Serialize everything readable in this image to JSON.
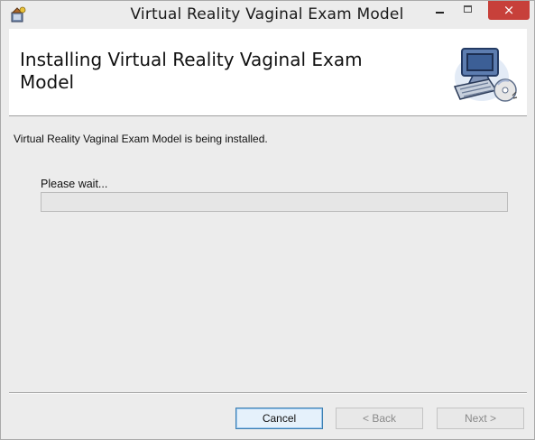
{
  "window": {
    "title": "Virtual Reality Vaginal Exam Model",
    "close_glyph": "×"
  },
  "banner": {
    "title": "Installing Virtual Reality Vaginal Exam Model",
    "image_icon": "computer-setup-icon"
  },
  "body": {
    "status": "Virtual Reality Vaginal Exam Model is being installed.",
    "wait_label": "Please wait...",
    "progress_fraction": 0
  },
  "buttons": {
    "cancel": "Cancel",
    "back": "< Back",
    "next": "Next >"
  },
  "colors": {
    "close_button": "#c7403a",
    "progress_fill": "#06b025"
  }
}
